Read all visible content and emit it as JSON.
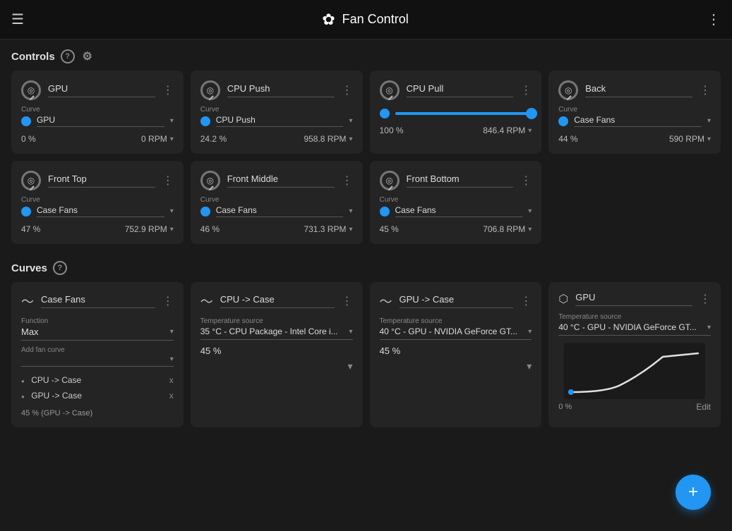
{
  "app": {
    "title": "Fan Control",
    "menu_icon": "☰",
    "dots_icon": "⋮",
    "fan_icon": "✦"
  },
  "sections": {
    "controls_label": "Controls",
    "curves_label": "Curves"
  },
  "controls": [
    {
      "id": "gpu",
      "title": "GPU",
      "curve_label": "Curve",
      "curve_name": "GPU",
      "percent": "0 %",
      "rpm": "0 RPM",
      "type": "normal"
    },
    {
      "id": "cpu-push",
      "title": "CPU Push",
      "curve_label": "Curve",
      "curve_name": "CPU Push",
      "percent": "24.2 %",
      "rpm": "958.8 RPM",
      "type": "normal"
    },
    {
      "id": "cpu-pull",
      "title": "CPU Pull",
      "curve_label": "",
      "curve_name": "",
      "percent": "100 %",
      "rpm": "846.4 RPM",
      "type": "slider",
      "slider_value": 100
    },
    {
      "id": "back",
      "title": "Back",
      "curve_label": "Curve",
      "curve_name": "Case Fans",
      "percent": "44 %",
      "rpm": "590 RPM",
      "type": "normal"
    },
    {
      "id": "front-top",
      "title": "Front Top",
      "curve_label": "Curve",
      "curve_name": "Case Fans",
      "percent": "47 %",
      "rpm": "752.9 RPM",
      "type": "normal"
    },
    {
      "id": "front-middle",
      "title": "Front Middle",
      "curve_label": "Curve",
      "curve_name": "Case Fans",
      "percent": "46 %",
      "rpm": "731.3 RPM",
      "type": "normal"
    },
    {
      "id": "front-bottom",
      "title": "Front Bottom",
      "curve_label": "Curve",
      "curve_name": "Case Fans",
      "percent": "45 %",
      "rpm": "706.8 RPM",
      "type": "normal"
    }
  ],
  "curves": [
    {
      "id": "case-fans",
      "title": "Case Fans",
      "icon": "∿",
      "type": "case-fans",
      "function_label": "Function",
      "function_value": "Max",
      "add_fan_label": "Add fan curve",
      "items": [
        "CPU -> Case",
        "GPU -> Case"
      ],
      "footer": "45 % (GPU -> Case)"
    },
    {
      "id": "cpu-case",
      "title": "CPU -> Case",
      "icon": "∿",
      "type": "temp",
      "temp_label": "Temperature source",
      "temp_value": "35 °C - CPU Package - Intel Core i...",
      "percent": "45 %"
    },
    {
      "id": "gpu-case",
      "title": "GPU -> Case",
      "icon": "∿",
      "type": "temp",
      "temp_label": "Temperature source",
      "temp_value": "40 °C - GPU - NVIDIA GeForce GT...",
      "percent": "45 %"
    },
    {
      "id": "gpu-curve",
      "title": "GPU",
      "icon": "⬡",
      "type": "chart",
      "temp_label": "Temperature source",
      "temp_value": "40 °C - GPU - NVIDIA GeForce GT...",
      "percent": "0 %",
      "edit_label": "Edit"
    }
  ],
  "fab": {
    "label": "+"
  }
}
